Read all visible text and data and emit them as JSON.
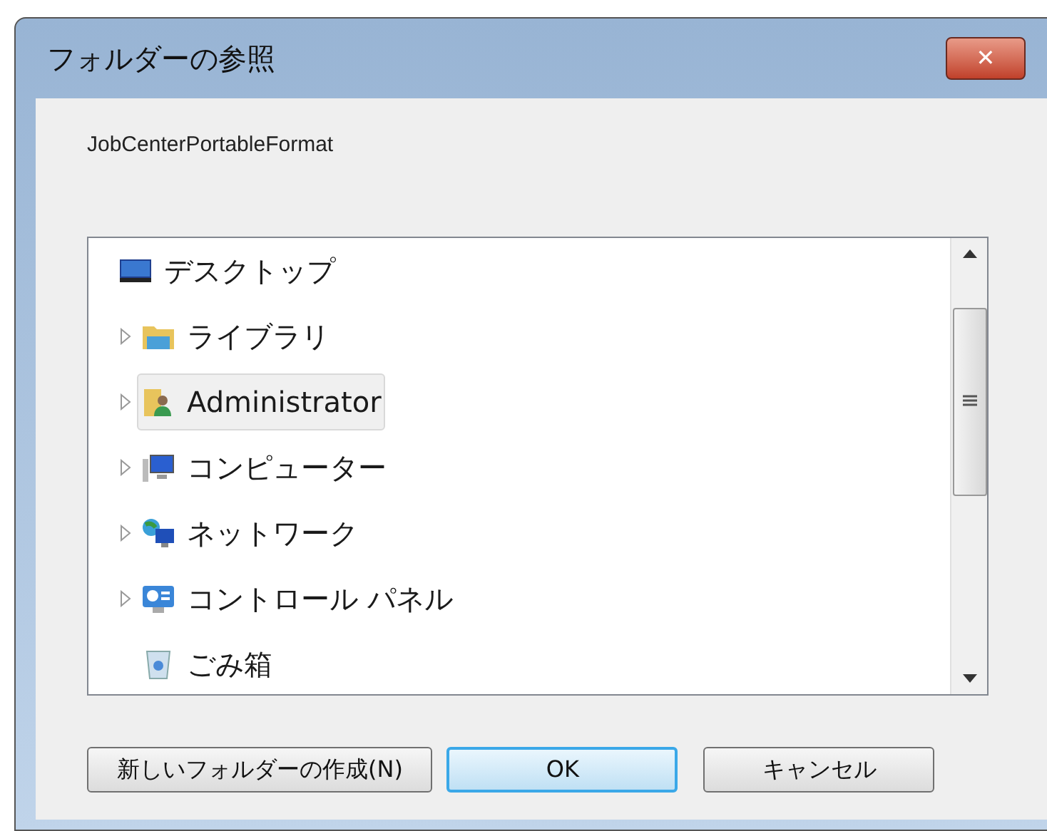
{
  "window": {
    "title": "フォルダーの参照",
    "close": "✕"
  },
  "description": "JobCenterPortableFormat",
  "tree": [
    {
      "label": "デスクトップ",
      "kind": "desktop",
      "expandable": false,
      "selected": false,
      "children": [
        {
          "label": "ライブラリ",
          "kind": "library",
          "expandable": true,
          "selected": false
        },
        {
          "label": "Administrator",
          "kind": "user",
          "expandable": true,
          "selected": true
        },
        {
          "label": "コンピューター",
          "kind": "computer",
          "expandable": true,
          "selected": false
        },
        {
          "label": "ネットワーク",
          "kind": "network",
          "expandable": true,
          "selected": false
        },
        {
          "label": "コントロール パネル",
          "kind": "control",
          "expandable": true,
          "selected": false
        },
        {
          "label": "ごみ箱",
          "kind": "trash",
          "expandable": false,
          "selected": false
        }
      ]
    }
  ],
  "buttons": [
    {
      "label": "新しいフォルダーの作成(N)",
      "default": false
    },
    {
      "label": "OK",
      "default": true
    },
    {
      "label": "キャンセル",
      "default": false
    }
  ]
}
